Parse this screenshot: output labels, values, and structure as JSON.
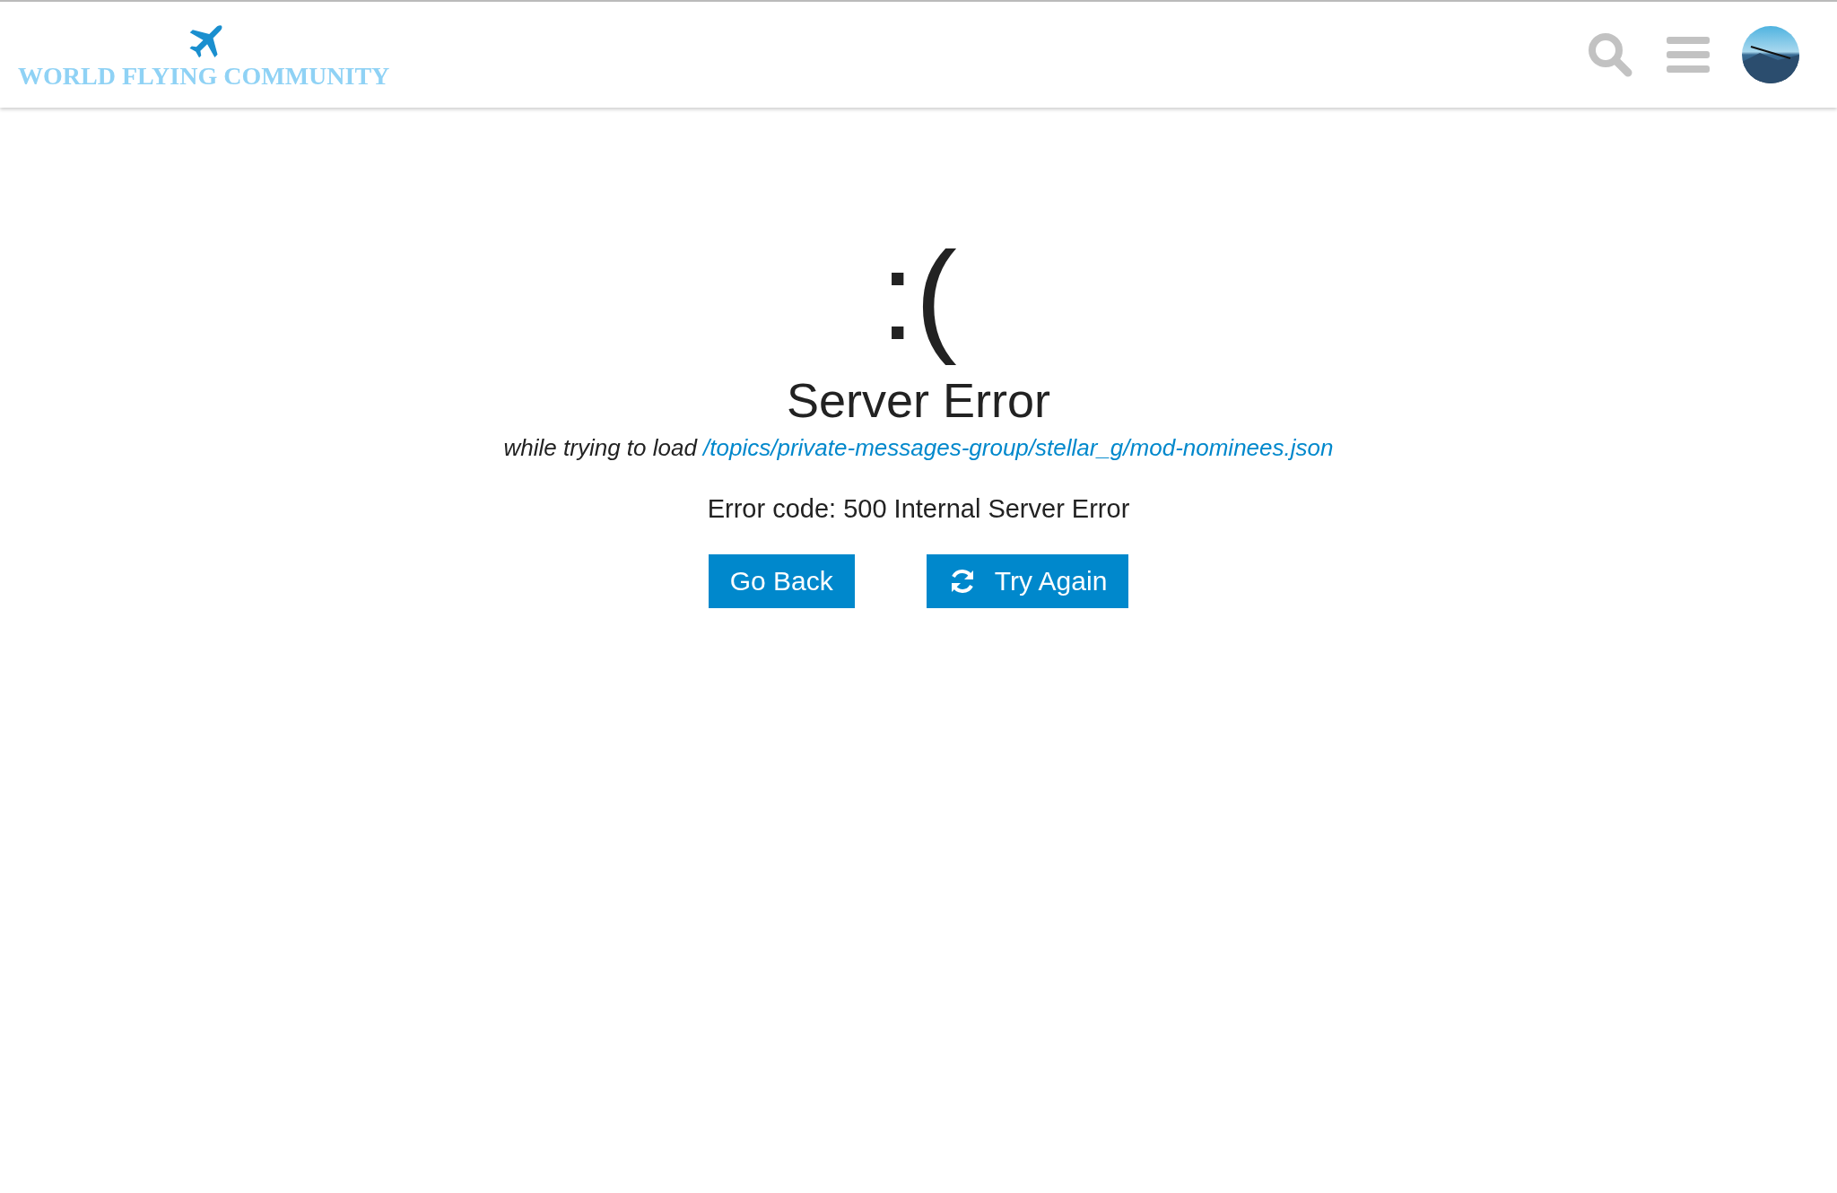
{
  "header": {
    "logo_text": "WORLD FLYING COMMUNITY"
  },
  "error": {
    "face": ":(",
    "title": "Server Error",
    "context": "while trying to load",
    "url": "/topics/private-messages-group/stellar_g/mod-nominees.json",
    "code": "Error code: 500 Internal Server Error"
  },
  "buttons": [
    {
      "label": "Go Back",
      "kind": "back"
    },
    {
      "label": "Try Again",
      "kind": "retry"
    }
  ]
}
